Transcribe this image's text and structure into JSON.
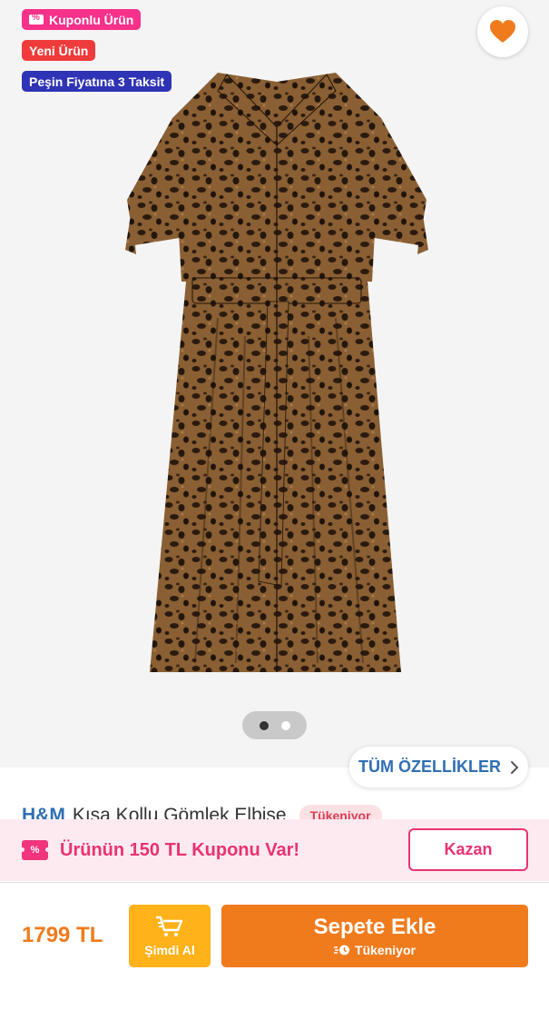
{
  "badges": {
    "coupon": "Kuponlu Ürün",
    "new": "Yeni Ürün",
    "installment": "Peşin Fiyatına 3 Taksit"
  },
  "gallery": {
    "current_image": 1,
    "image_count": 2
  },
  "features_button": {
    "label": "TÜM ÖZELLİKLER"
  },
  "product": {
    "brand": "H&M",
    "name": "Kısa Kollu Gömlek Elbise",
    "stock_status": "Tükeniyor"
  },
  "coupon_bar": {
    "text": "Ürünün 150 TL Kuponu Var!",
    "button_label": "Kazan"
  },
  "purchase": {
    "price": "1799 TL",
    "buy_now_label": "Şimdi Al",
    "add_to_cart_label": "Sepete Ekle",
    "stock_note": "Tükeniyor"
  },
  "colors": {
    "accent_orange": "#f07b1d",
    "buy_now_yellow": "#ffb21a",
    "coupon_pink": "#e9336f",
    "link_blue": "#2f6fb4"
  },
  "icons": [
    "heart-icon",
    "coupon-icon",
    "chevron-right-icon",
    "cart-icon",
    "clock-icon"
  ]
}
